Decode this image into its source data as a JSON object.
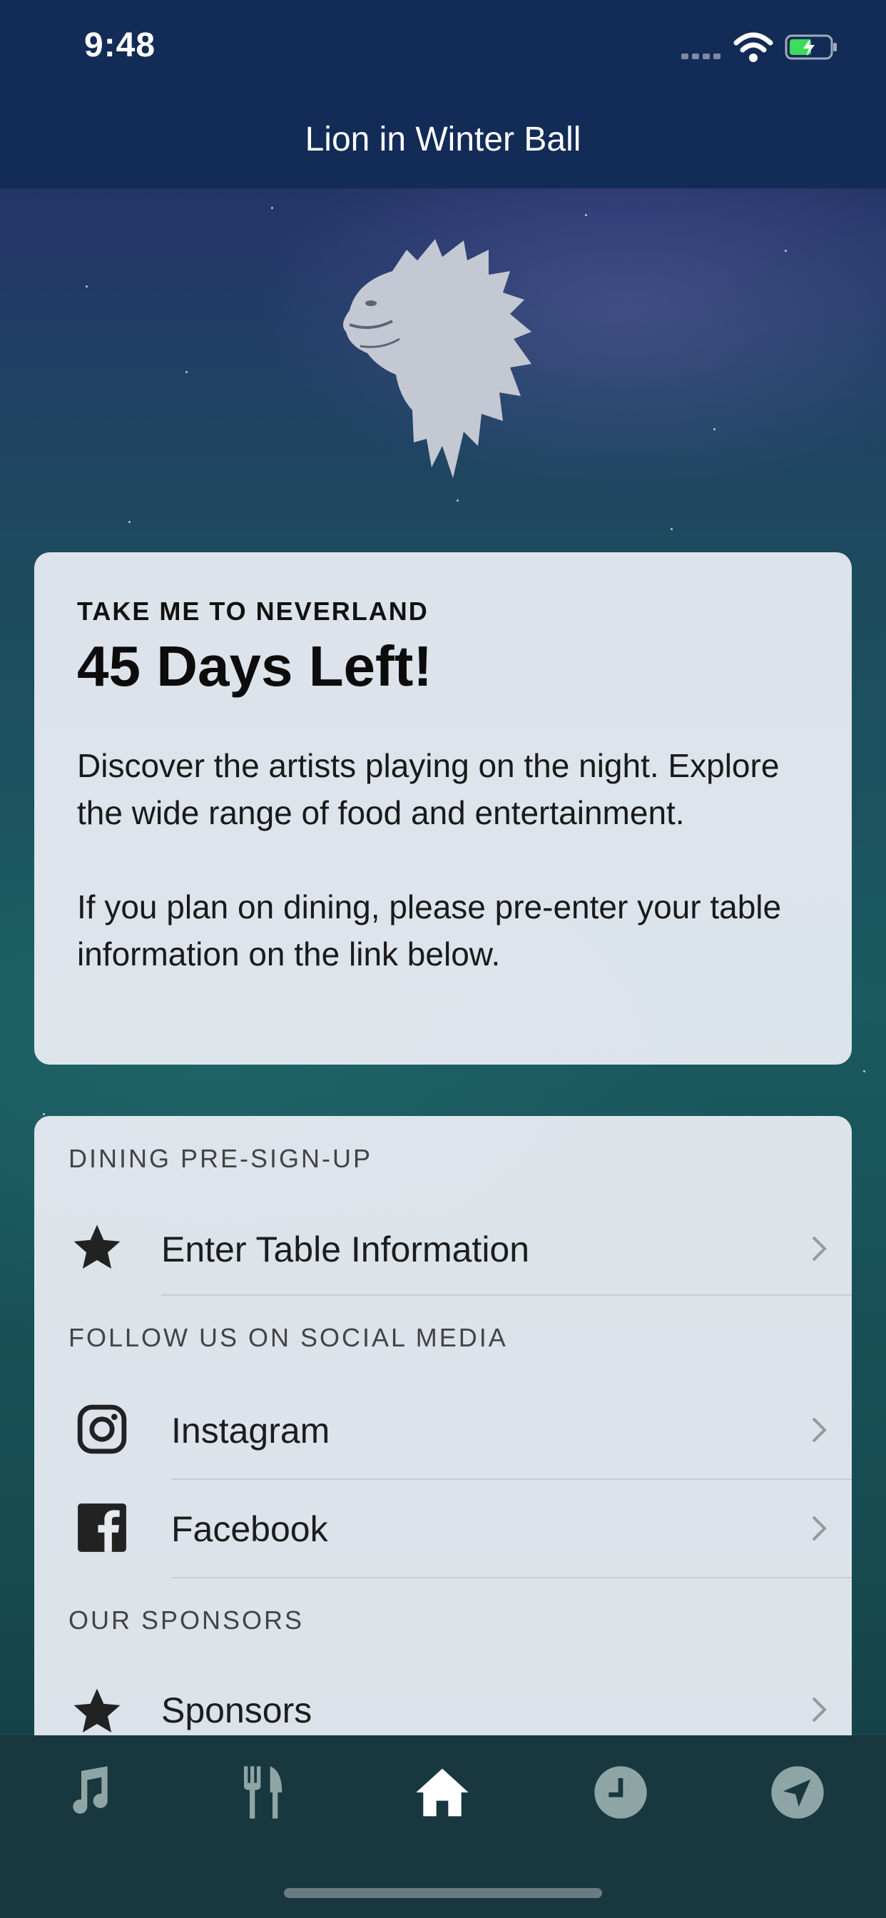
{
  "status_bar": {
    "time": "9:48"
  },
  "nav": {
    "title": "Lion in Winter Ball"
  },
  "countdown_card": {
    "kicker": "TAKE ME TO NEVERLAND",
    "days_left": "45 Days Left!",
    "description": "Discover the artists playing on the night. Explore the wide range of food and entertainment.\n\nIf you plan on dining, please pre-enter your table information on the link below."
  },
  "links_card": {
    "sections": [
      {
        "heading": "DINING PRE-SIGN-UP",
        "items": [
          {
            "label": "Enter Table Information",
            "icon": "star-icon"
          }
        ]
      },
      {
        "heading": "FOLLOW US ON SOCIAL MEDIA",
        "items": [
          {
            "label": "Instagram",
            "icon": "instagram-icon"
          },
          {
            "label": "Facebook",
            "icon": "facebook-icon"
          }
        ]
      },
      {
        "heading": "OUR SPONSORS",
        "items": [
          {
            "label": "Sponsors",
            "icon": "star-icon"
          }
        ]
      }
    ]
  },
  "tab_bar": {
    "tabs": [
      {
        "icon": "music-note-icon",
        "active": false
      },
      {
        "icon": "fork-knife-icon",
        "active": false
      },
      {
        "icon": "home-icon",
        "active": true
      },
      {
        "icon": "clock-icon",
        "active": false
      },
      {
        "icon": "location-arrow-icon",
        "active": false
      }
    ]
  },
  "colors": {
    "nav_background": "#132b57",
    "tab_background": "#19373e",
    "tab_inactive": "#8fa5a5",
    "tab_active": "#ffffff"
  }
}
